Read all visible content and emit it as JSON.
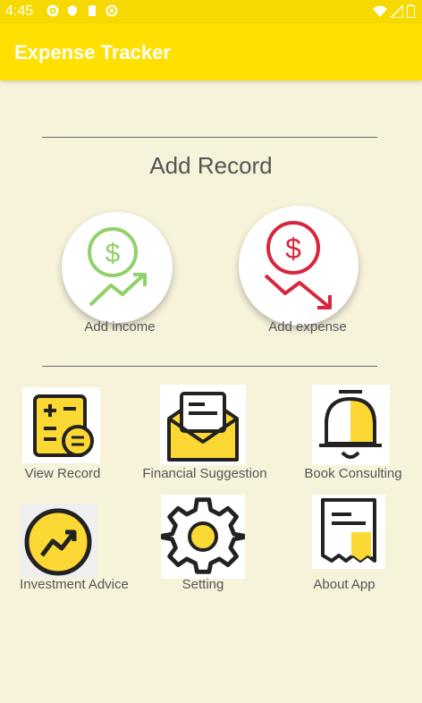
{
  "status_bar": {
    "time": "4:45",
    "icons": [
      "gear-icon",
      "shield-icon",
      "sd-card-icon",
      "sync-icon",
      "wifi-icon",
      "signal-icon",
      "battery-icon"
    ]
  },
  "app_bar": {
    "title": "Expense Tracker"
  },
  "add_record": {
    "title": "Add Record",
    "income_label": "Add income",
    "expense_label": "Add expense"
  },
  "menu": {
    "view_record": "View Record",
    "financial_suggestion": "Financial Suggestion",
    "book_consulting": "Book Consulting",
    "investment_advice": "Investment Advice",
    "setting": "Setting",
    "about_app": "About App"
  },
  "colors": {
    "background": "#f7f2da",
    "app_bar": "#ffe000",
    "income_green": "#8fd16a",
    "expense_red": "#d7263d",
    "icon_yellow": "#fcd835",
    "icon_dark": "#222222"
  }
}
